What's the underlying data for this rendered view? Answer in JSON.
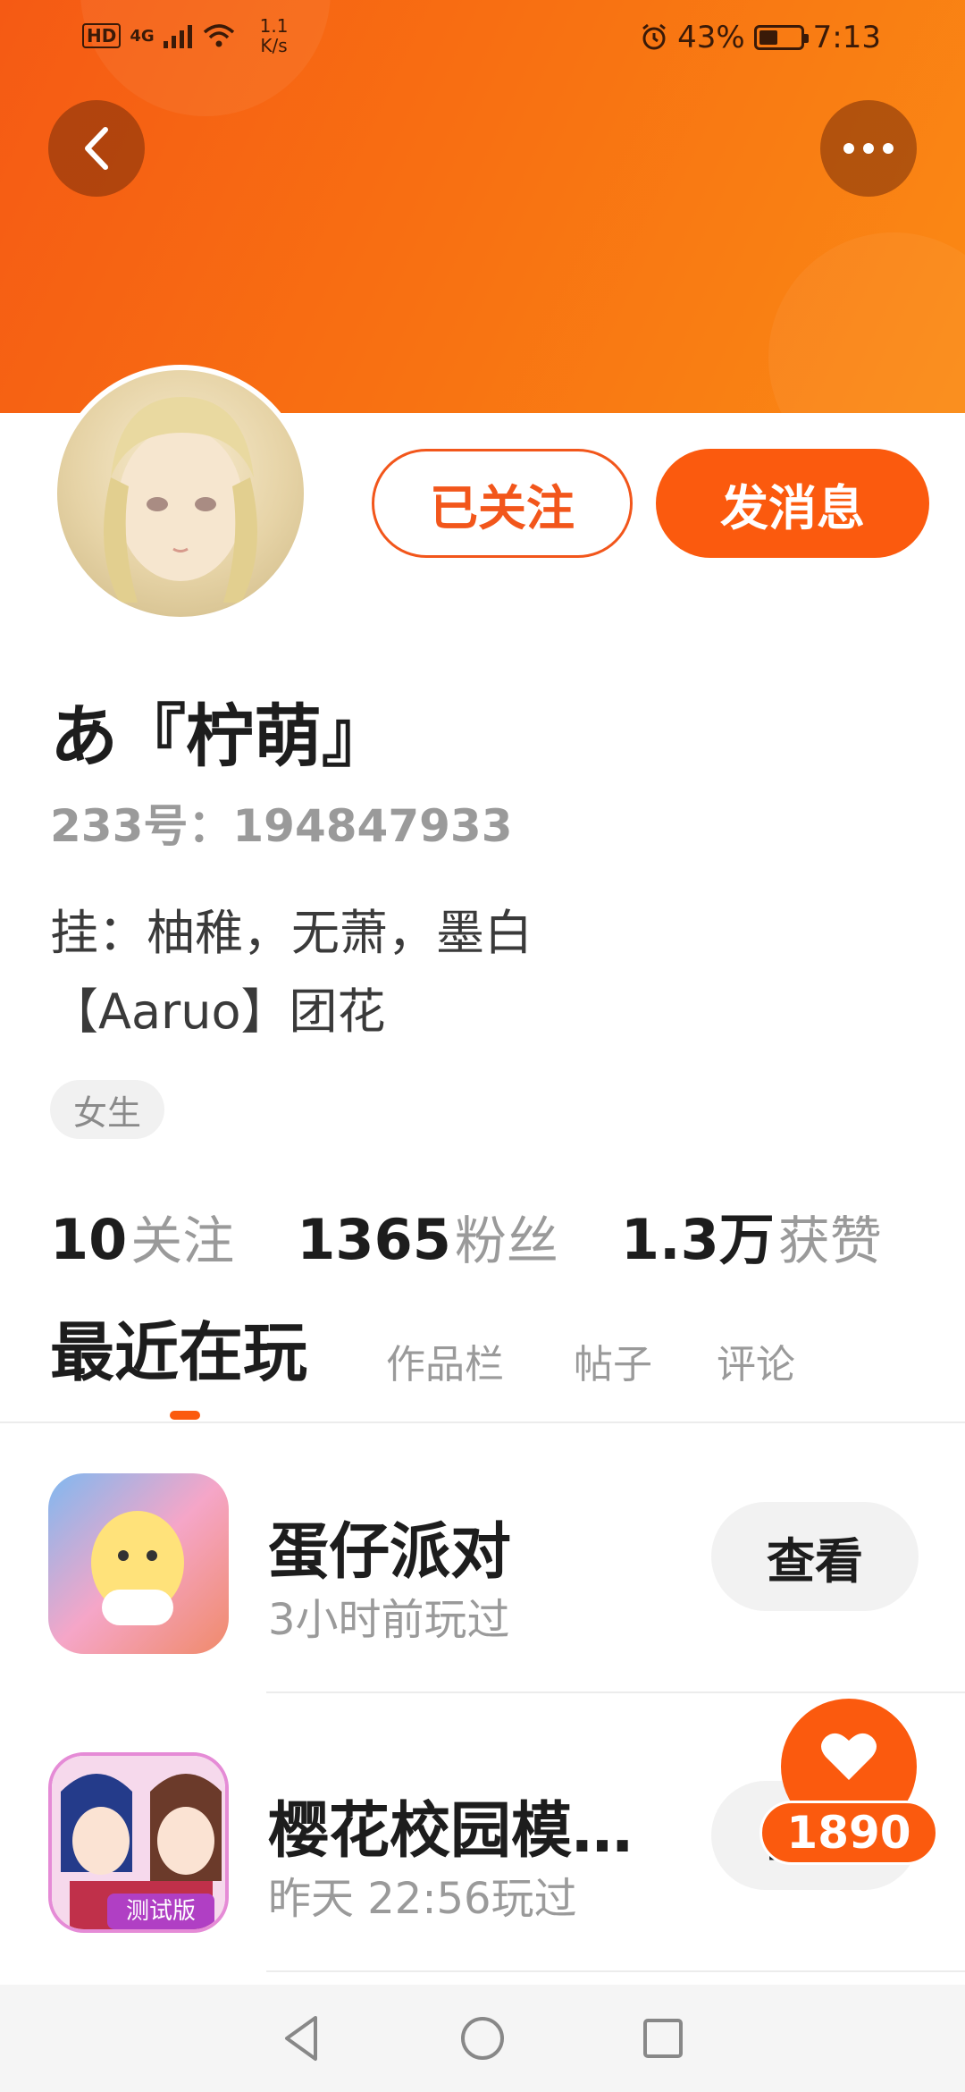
{
  "status_bar": {
    "hd": "HD",
    "network": "4G",
    "speed_value": "1.1",
    "speed_unit": "K/s",
    "battery_percent": "43%",
    "time": "7:13"
  },
  "header": {
    "back_icon": "chevron-left-icon",
    "more_icon": "more-horizontal-icon"
  },
  "profile": {
    "follow_label": "已关注",
    "message_label": "发消息",
    "username": "あ『柠萌』",
    "user_id": "233号：194847933",
    "bio_line1": "挂：柚稚，无萧，墨白",
    "bio_line2": "【Aaruo】团花",
    "gender": "女生"
  },
  "stats": [
    {
      "num": "10",
      "label": "关注"
    },
    {
      "num": "1365",
      "label": "粉丝"
    },
    {
      "num": "1.3万",
      "label": "获赞"
    }
  ],
  "tabs": {
    "active": "最近在玩",
    "works": "作品栏",
    "posts": "帖子",
    "comments": "评论"
  },
  "games": [
    {
      "name": "蛋仔派对",
      "time": "3小时前玩过",
      "action": "查看"
    },
    {
      "name": "樱花校园模…",
      "time": "昨天 22:56玩过",
      "action": "查看",
      "badge": "测试版"
    }
  ],
  "like_float": {
    "count": "1890"
  },
  "colors": {
    "accent": "#fb5a0e",
    "header_start": "#f55a14",
    "header_end": "#fa8a14"
  }
}
